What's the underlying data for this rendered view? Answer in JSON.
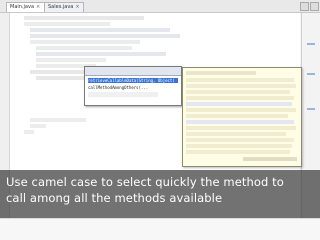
{
  "editor": {
    "tabs": [
      {
        "label": "Main.java"
      },
      {
        "label": "Sales.java"
      }
    ]
  },
  "completion": {
    "rows": [
      "retrieveCallableData(String, Object) : String",
      "callMethodAmongOthers(..."
    ]
  },
  "caption": {
    "line1": "Use camel case to select quickly the method to",
    "line2": "call among all the methods available"
  }
}
